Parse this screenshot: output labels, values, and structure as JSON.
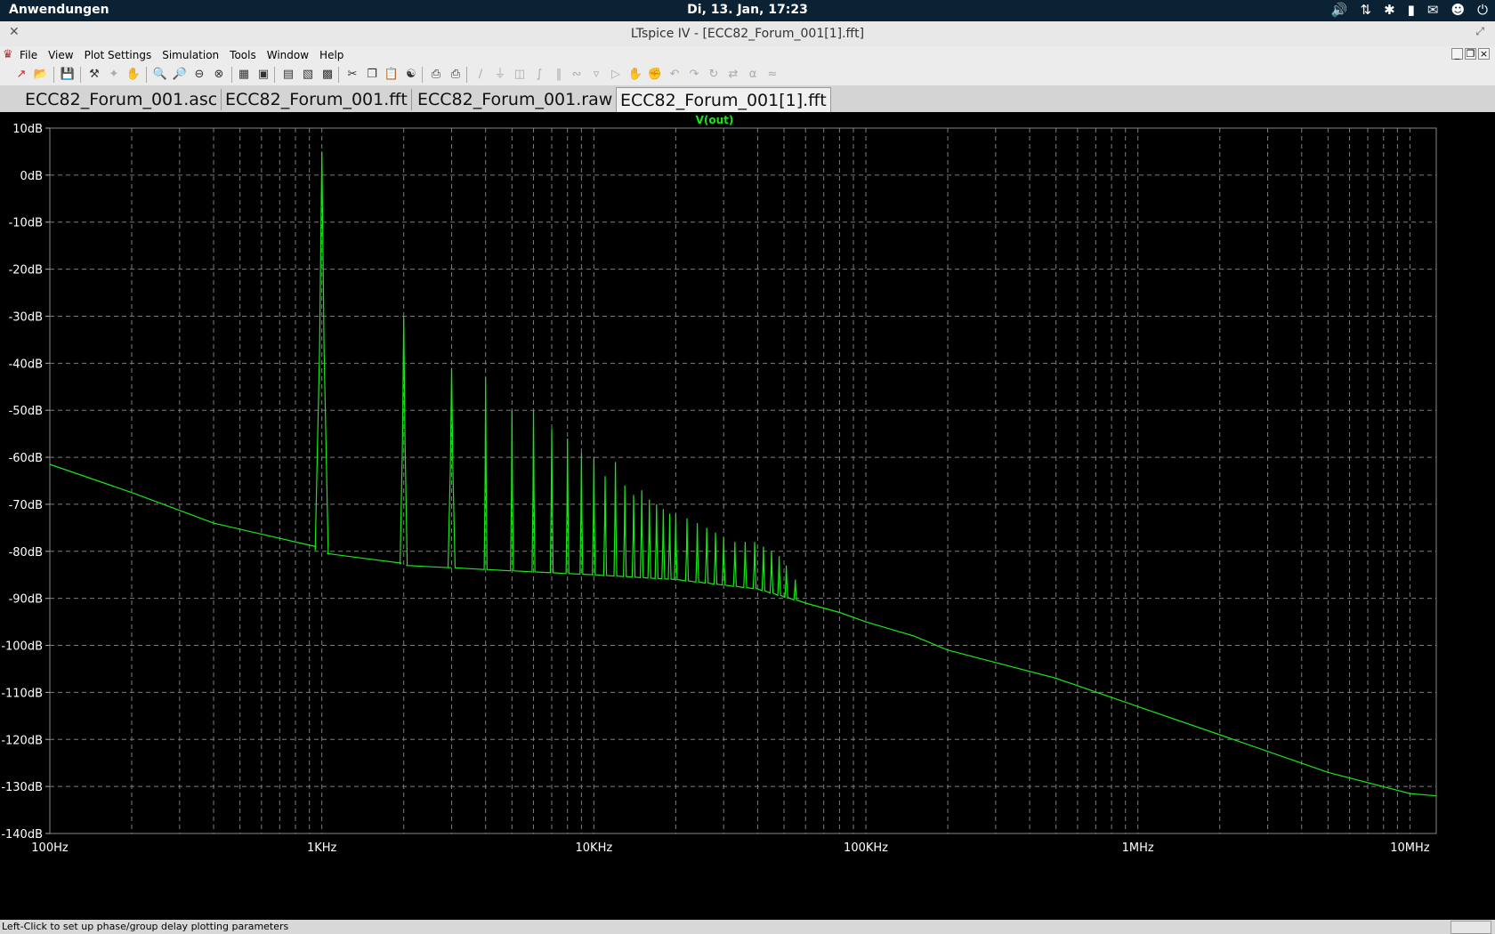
{
  "topbar": {
    "apps_label": "Anwendungen",
    "clock": "Di, 13. Jan, 17:23"
  },
  "window": {
    "title": "LTspice IV - [ECC82_Forum_001[1].fft]"
  },
  "menu": {
    "items": [
      "File",
      "View",
      "Plot Settings",
      "Simulation",
      "Tools",
      "Window",
      "Help"
    ]
  },
  "tabs": [
    {
      "label": "ECC82_Forum_001.asc",
      "active": false
    },
    {
      "label": "ECC82_Forum_001.fft",
      "active": false
    },
    {
      "label": "ECC82_Forum_001.raw",
      "active": false
    },
    {
      "label": "ECC82_Forum_001[1].fft",
      "active": true
    }
  ],
  "status": {
    "message": "Left-Click to set up phase/group delay plotting parameters"
  },
  "colors": {
    "trace": "#19e619",
    "plot_bg": "#000000",
    "grid": "#7f7f7f",
    "axis_text": "#ffffff"
  },
  "chart_data": {
    "type": "line",
    "title": "V(out)",
    "x_scale": "log",
    "xlim": [
      100,
      12500000
    ],
    "ylim": [
      -140,
      10
    ],
    "x_ticks": [
      {
        "value": 100,
        "label": "100Hz"
      },
      {
        "value": 1000,
        "label": "1KHz"
      },
      {
        "value": 10000,
        "label": "10KHz"
      },
      {
        "value": 100000,
        "label": "100KHz"
      },
      {
        "value": 1000000,
        "label": "1MHz"
      },
      {
        "value": 10000000,
        "label": "10MHz"
      }
    ],
    "y_ticks": [
      {
        "value": 10,
        "label": "10dB"
      },
      {
        "value": 0,
        "label": "0dB"
      },
      {
        "value": -10,
        "label": "-10dB"
      },
      {
        "value": -20,
        "label": "-20dB"
      },
      {
        "value": -30,
        "label": "-30dB"
      },
      {
        "value": -40,
        "label": "-40dB"
      },
      {
        "value": -50,
        "label": "-50dB"
      },
      {
        "value": -60,
        "label": "-60dB"
      },
      {
        "value": -70,
        "label": "-70dB"
      },
      {
        "value": -80,
        "label": "-80dB"
      },
      {
        "value": -90,
        "label": "-90dB"
      },
      {
        "value": -100,
        "label": "-100dB"
      },
      {
        "value": -110,
        "label": "-110dB"
      },
      {
        "value": -120,
        "label": "-120dB"
      },
      {
        "value": -130,
        "label": "-130dB"
      },
      {
        "value": -140,
        "label": "-140dB"
      }
    ],
    "grid": true,
    "series": [
      {
        "name": "V(out)",
        "noise_floor": [
          [
            100,
            -61.5
          ],
          [
            200,
            -67.5
          ],
          [
            400,
            -74
          ],
          [
            950,
            -79
          ],
          [
            1050,
            -80.5
          ],
          [
            1950,
            -82.5
          ],
          [
            2050,
            -83
          ],
          [
            3000,
            -83.5
          ],
          [
            10000,
            -85
          ],
          [
            20000,
            -86
          ],
          [
            40000,
            -88
          ],
          [
            60000,
            -91
          ],
          [
            80000,
            -93
          ],
          [
            100000,
            -95
          ],
          [
            150000,
            -98
          ],
          [
            200000,
            -101
          ],
          [
            500000,
            -107
          ],
          [
            1000000,
            -113
          ],
          [
            2000000,
            -119
          ],
          [
            5000000,
            -127
          ],
          [
            10000000,
            -131.5
          ],
          [
            12500000,
            -132
          ]
        ],
        "harmonics": [
          {
            "f": 1000,
            "db": 5
          },
          {
            "f": 2000,
            "db": -30
          },
          {
            "f": 3000,
            "db": -41
          },
          {
            "f": 4000,
            "db": -43
          },
          {
            "f": 5000,
            "db": -50
          },
          {
            "f": 6000,
            "db": -50
          },
          {
            "f": 7000,
            "db": -54
          },
          {
            "f": 8000,
            "db": -56
          },
          {
            "f": 9000,
            "db": -59
          },
          {
            "f": 10000,
            "db": -60
          },
          {
            "f": 11000,
            "db": -64
          },
          {
            "f": 12000,
            "db": -61
          },
          {
            "f": 13000,
            "db": -66
          },
          {
            "f": 14000,
            "db": -68
          },
          {
            "f": 15000,
            "db": -67
          },
          {
            "f": 16000,
            "db": -69
          },
          {
            "f": 17000,
            "db": -70
          },
          {
            "f": 18000,
            "db": -71
          },
          {
            "f": 19000,
            "db": -72
          },
          {
            "f": 20000,
            "db": -72
          },
          {
            "f": 22000,
            "db": -73
          },
          {
            "f": 24000,
            "db": -74
          },
          {
            "f": 26000,
            "db": -75
          },
          {
            "f": 28000,
            "db": -76
          },
          {
            "f": 30000,
            "db": -77
          },
          {
            "f": 33000,
            "db": -78
          },
          {
            "f": 36000,
            "db": -78
          },
          {
            "f": 39000,
            "db": -78
          },
          {
            "f": 42000,
            "db": -79
          },
          {
            "f": 45000,
            "db": -80
          },
          {
            "f": 48000,
            "db": -81
          },
          {
            "f": 51000,
            "db": -83
          },
          {
            "f": 55000,
            "db": -86
          }
        ]
      }
    ]
  }
}
